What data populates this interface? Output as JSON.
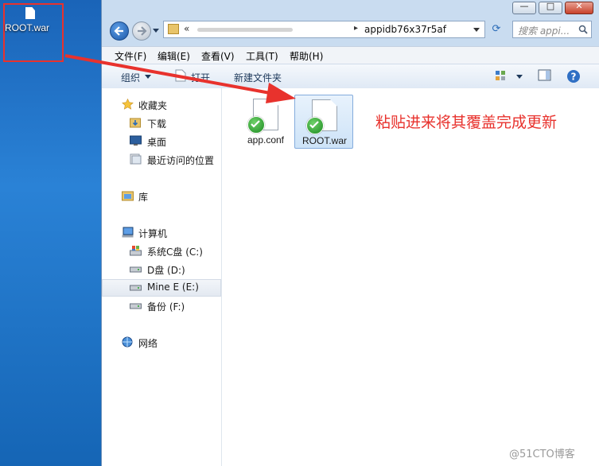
{
  "desktop": {
    "icon_label": "ROOT.war"
  },
  "window": {
    "title_buttons": {
      "minimize": "—",
      "maximize": "□",
      "close": "✕"
    },
    "address": {
      "chevron": "«",
      "separator": "▸",
      "current_folder": "appidb76x37r5af"
    },
    "search_placeholder": "搜索 appi...",
    "menu": [
      "文件(F)",
      "编辑(E)",
      "查看(V)",
      "工具(T)",
      "帮助(H)"
    ],
    "toolbar": {
      "organize": "组织",
      "open": "打开",
      "new_folder": "新建文件夹"
    },
    "nav": {
      "favorites": "收藏夹",
      "downloads": "下载",
      "desktop": "桌面",
      "recent": "最近访问的位置",
      "libraries": "库",
      "computer": "计算机",
      "drive_c": "系统C盘 (C:)",
      "drive_d": "D盘 (D:)",
      "drive_e": "Mine E (E:)",
      "drive_f": "备份 (F:)",
      "network": "网络"
    },
    "files": [
      {
        "name": "app.conf",
        "selected": false
      },
      {
        "name": "ROOT.war",
        "selected": true
      }
    ]
  },
  "annotation": "粘贴进来将其覆盖完成更新",
  "watermark": "@51CTO博客",
  "colors": {
    "annotation_red": "#e8322d",
    "selection_blue": "#cde3f8"
  }
}
